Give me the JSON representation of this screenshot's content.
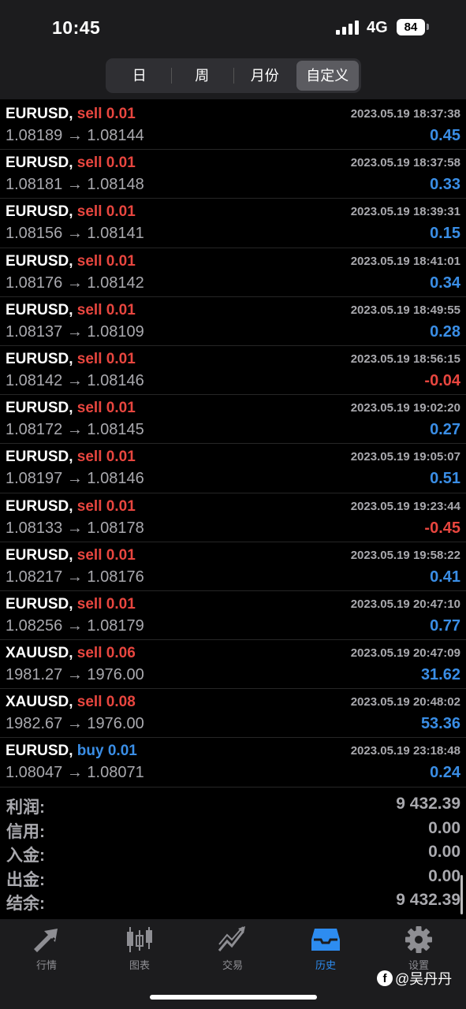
{
  "status_bar": {
    "time": "10:45",
    "network": "4G",
    "battery": "84"
  },
  "period_tabs": [
    {
      "label": "日",
      "active": false
    },
    {
      "label": "周",
      "active": false
    },
    {
      "label": "月份",
      "active": false
    },
    {
      "label": "自定义",
      "active": true
    }
  ],
  "deals": [
    {
      "symbol": "EURUSD,",
      "side": "sell",
      "volume": "0.01",
      "datetime": "2023.05.19 18:37:38",
      "open_price": "1.08189",
      "close_price": "1.08144",
      "profit": "0.45"
    },
    {
      "symbol": "EURUSD,",
      "side": "sell",
      "volume": "0.01",
      "datetime": "2023.05.19 18:37:58",
      "open_price": "1.08181",
      "close_price": "1.08148",
      "profit": "0.33"
    },
    {
      "symbol": "EURUSD,",
      "side": "sell",
      "volume": "0.01",
      "datetime": "2023.05.19 18:39:31",
      "open_price": "1.08156",
      "close_price": "1.08141",
      "profit": "0.15"
    },
    {
      "symbol": "EURUSD,",
      "side": "sell",
      "volume": "0.01",
      "datetime": "2023.05.19 18:41:01",
      "open_price": "1.08176",
      "close_price": "1.08142",
      "profit": "0.34"
    },
    {
      "symbol": "EURUSD,",
      "side": "sell",
      "volume": "0.01",
      "datetime": "2023.05.19 18:49:55",
      "open_price": "1.08137",
      "close_price": "1.08109",
      "profit": "0.28"
    },
    {
      "symbol": "EURUSD,",
      "side": "sell",
      "volume": "0.01",
      "datetime": "2023.05.19 18:56:15",
      "open_price": "1.08142",
      "close_price": "1.08146",
      "profit": "-0.04"
    },
    {
      "symbol": "EURUSD,",
      "side": "sell",
      "volume": "0.01",
      "datetime": "2023.05.19 19:02:20",
      "open_price": "1.08172",
      "close_price": "1.08145",
      "profit": "0.27"
    },
    {
      "symbol": "EURUSD,",
      "side": "sell",
      "volume": "0.01",
      "datetime": "2023.05.19 19:05:07",
      "open_price": "1.08197",
      "close_price": "1.08146",
      "profit": "0.51"
    },
    {
      "symbol": "EURUSD,",
      "side": "sell",
      "volume": "0.01",
      "datetime": "2023.05.19 19:23:44",
      "open_price": "1.08133",
      "close_price": "1.08178",
      "profit": "-0.45"
    },
    {
      "symbol": "EURUSD,",
      "side": "sell",
      "volume": "0.01",
      "datetime": "2023.05.19 19:58:22",
      "open_price": "1.08217",
      "close_price": "1.08176",
      "profit": "0.41"
    },
    {
      "symbol": "EURUSD,",
      "side": "sell",
      "volume": "0.01",
      "datetime": "2023.05.19 20:47:10",
      "open_price": "1.08256",
      "close_price": "1.08179",
      "profit": "0.77"
    },
    {
      "symbol": "XAUUSD,",
      "side": "sell",
      "volume": "0.06",
      "datetime": "2023.05.19 20:47:09",
      "open_price": "1981.27",
      "close_price": "1976.00",
      "profit": "31.62"
    },
    {
      "symbol": "XAUUSD,",
      "side": "sell",
      "volume": "0.08",
      "datetime": "2023.05.19 20:48:02",
      "open_price": "1982.67",
      "close_price": "1976.00",
      "profit": "53.36"
    },
    {
      "symbol": "EURUSD,",
      "side": "buy",
      "volume": "0.01",
      "datetime": "2023.05.19 23:18:48",
      "open_price": "1.08047",
      "close_price": "1.08071",
      "profit": "0.24"
    }
  ],
  "arrow": "→",
  "summary": [
    {
      "label": "利润:",
      "value": "9 432.39"
    },
    {
      "label": "信用:",
      "value": "0.00"
    },
    {
      "label": "入金:",
      "value": "0.00"
    },
    {
      "label": "出金:",
      "value": "0.00"
    },
    {
      "label": "结余:",
      "value": "9 432.39"
    }
  ],
  "tab_bar": [
    {
      "label": "行情",
      "icon": "quotes-arrows-icon",
      "active": false
    },
    {
      "label": "图表",
      "icon": "candlestick-chart-icon",
      "active": false
    },
    {
      "label": "交易",
      "icon": "trade-chart-icon",
      "active": false
    },
    {
      "label": "历史",
      "icon": "history-tray-icon",
      "active": true
    },
    {
      "label": "设置",
      "icon": "gear-icon",
      "active": false
    }
  ],
  "watermark": "@吴丹丹",
  "colors": {
    "sell": "#e8463f",
    "buy": "#3a8ee6",
    "profit_positive": "#3a8ee6",
    "profit_negative": "#e8463f",
    "active_tab": "#2d8cf0"
  }
}
